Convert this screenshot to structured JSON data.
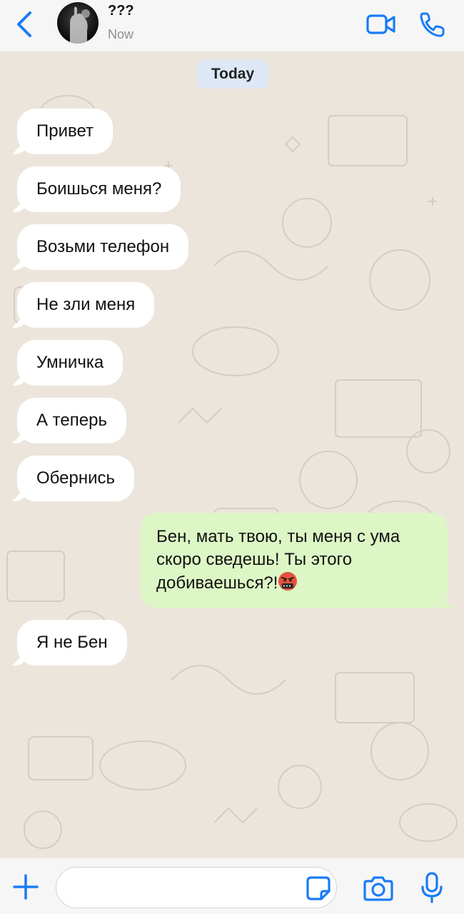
{
  "header": {
    "contact_name": "???",
    "contact_status": "Now",
    "icons": [
      "chevron-left-icon",
      "avatar",
      "video-camera-icon",
      "phone-icon"
    ]
  },
  "chat": {
    "date_label": "Today",
    "messages": [
      {
        "direction": "incoming",
        "text": "Привет"
      },
      {
        "direction": "incoming",
        "text": "Боишься меня?"
      },
      {
        "direction": "incoming",
        "text": "Возьми телефон"
      },
      {
        "direction": "incoming",
        "text": "Не зли меня"
      },
      {
        "direction": "incoming",
        "text": "Умничка"
      },
      {
        "direction": "incoming",
        "text": "А теперь"
      },
      {
        "direction": "incoming",
        "text": "Обернись"
      },
      {
        "direction": "outgoing",
        "text": "Бен, мать твою, ты меня с ума скоро сведешь! Ты этого добиваешься?!",
        "emoji": "cursing-face"
      },
      {
        "direction": "incoming",
        "text": "Я не Бен"
      }
    ]
  },
  "composer": {
    "input_value": "",
    "placeholder": "",
    "icons": [
      "plus-icon",
      "sticker-icon",
      "camera-icon",
      "microphone-icon"
    ]
  },
  "colors": {
    "accent": "#1a7cf5",
    "incoming_bubble": "#ffffff",
    "outgoing_bubble": "#dcf7c5",
    "chat_background": "#ece5dc",
    "date_chip": "#dde7f5"
  }
}
